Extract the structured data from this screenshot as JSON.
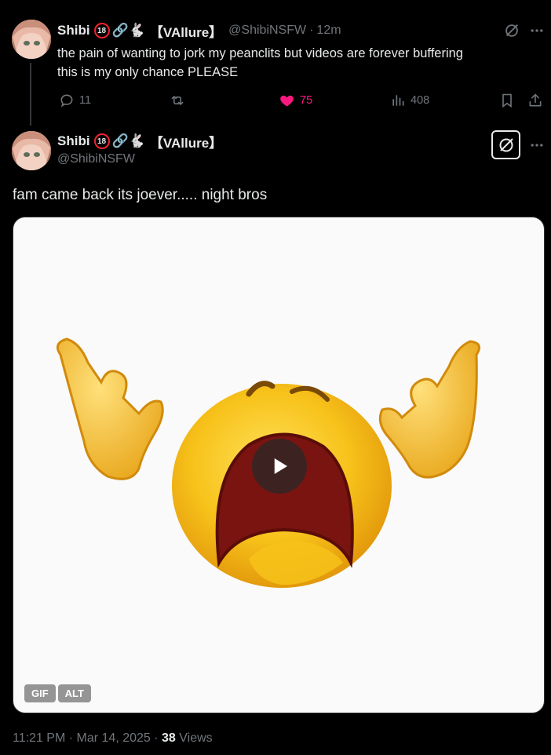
{
  "parent": {
    "name": "Shibi",
    "badge": "18",
    "emojis": "🔗🐇",
    "tag": "【VAllure】",
    "handle": "@ShibiNSFW",
    "separator": "·",
    "time": "12m",
    "text_line1": "the pain of wanting to jork my peanclits but videos are forever buffering",
    "text_line2": "this is my only chance PLEASE",
    "replies": "11",
    "likes": "75",
    "views": "408",
    "icons": [
      "reply-icon",
      "retweet-icon",
      "like-icon",
      "views-icon",
      "bookmark-icon",
      "share-icon",
      "grok-icon",
      "more-icon"
    ]
  },
  "tweet": {
    "name": "Shibi",
    "badge": "18",
    "emojis": "🔗🐇",
    "tag": "【VAllure】",
    "handle": "@ShibiNSFW",
    "text": "fam came back its joever..... night bros",
    "media": {
      "type": "gif",
      "gif_label": "GIF",
      "alt_label": "ALT"
    },
    "timestamp": "11:21 PM · Mar 14, 2025 · ",
    "views_count": "38",
    "views_label": " Views"
  },
  "colors": {
    "background": "#000000",
    "text": "#e7e9ea",
    "muted": "#71767b",
    "like": "#f91880",
    "badge_ring": "#f4212e"
  }
}
